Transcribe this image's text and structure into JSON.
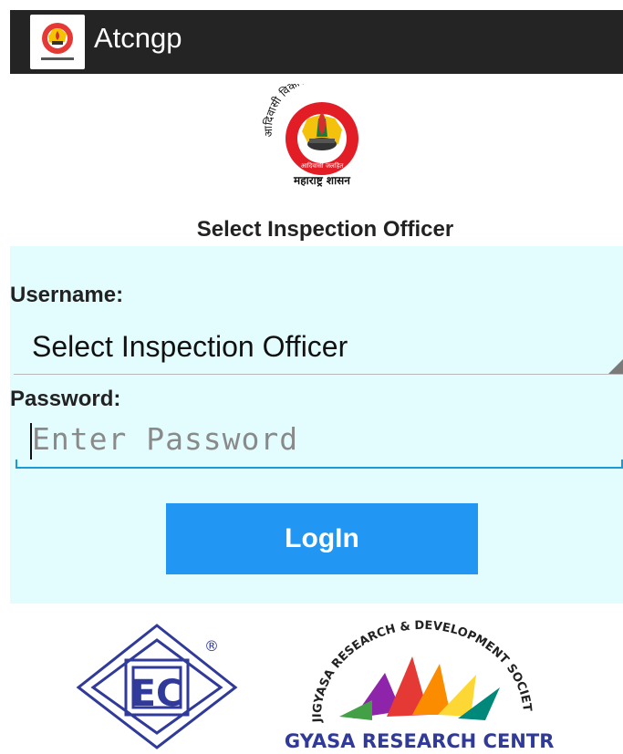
{
  "app": {
    "title": "Atcngp"
  },
  "logo": {
    "arc_text": "आदिवासी विकास विभाग",
    "footer_text": "महाराष्ट्र शासन",
    "inner_text": "आदिवासी जलहित"
  },
  "form": {
    "heading": "Select Inspection Officer",
    "username_label": "Username:",
    "username_selected": "Select Inspection Officer",
    "password_label": "Password:",
    "password_placeholder": "Enter Password",
    "login_label": "LogIn"
  },
  "partners": {
    "ec_text": "EC",
    "ec_mark": "®",
    "jigyasa_arc": "JIGYASA RESEARCH & DEVELOPMENT SOCIETY'S",
    "jigyasa_name": "JIGYASA RESEARCH CENTRE"
  },
  "colors": {
    "appbar": "#242424",
    "panel": "#e3fdff",
    "button": "#2196f3",
    "accent_line": "#1a9bd6"
  }
}
